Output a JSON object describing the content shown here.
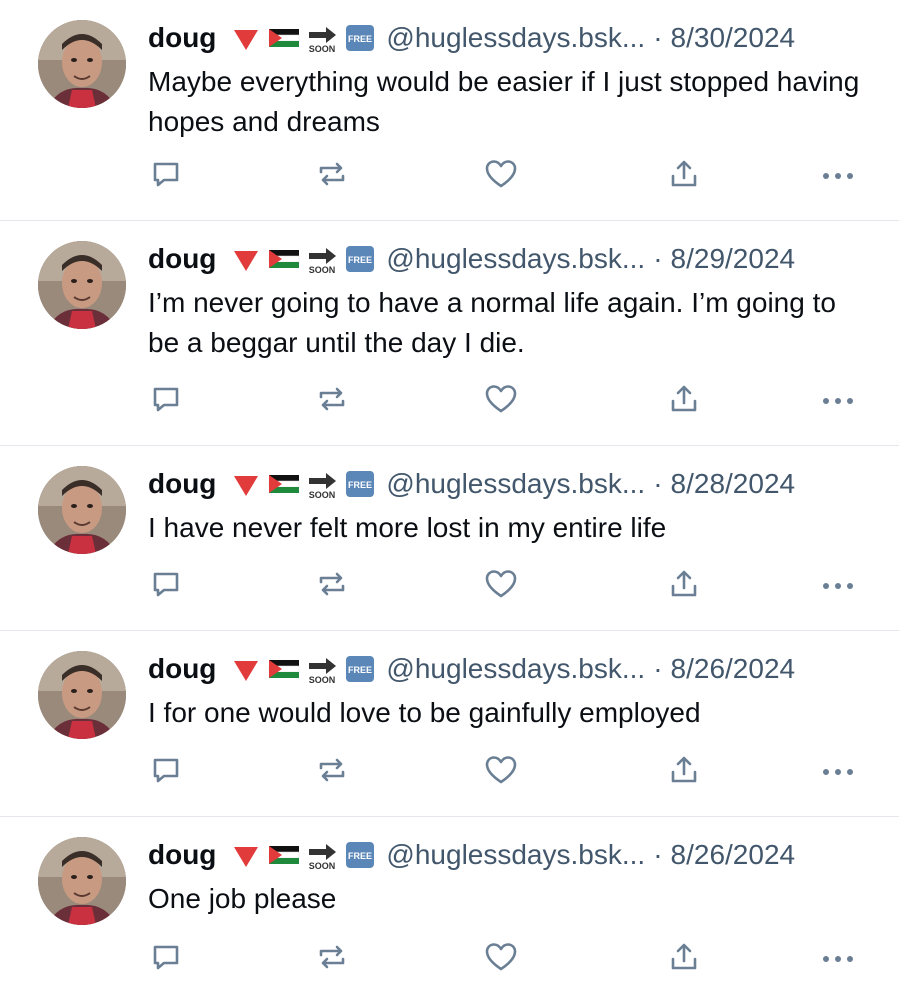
{
  "colors": {
    "text_primary": "#0b0f14",
    "text_secondary": "#42576c",
    "icon": "#6a7f94",
    "divider": "#e4e8ec",
    "flag_red": "#e23b3b",
    "flag_green": "#1f8a3b",
    "free_blue": "#5b86b8"
  },
  "posts": [
    {
      "author_name": "doug",
      "emojis": [
        "red-triangle-down-icon",
        "palestine-flag-icon",
        "soon-arrow-icon",
        "free-button-icon"
      ],
      "handle": "@huglessdays.bsk...",
      "separator": "·",
      "date": "8/30/2024",
      "text": "Maybe everything would be easier if I just stopped having hopes and dreams"
    },
    {
      "author_name": "doug",
      "emojis": [
        "red-triangle-down-icon",
        "palestine-flag-icon",
        "soon-arrow-icon",
        "free-button-icon"
      ],
      "handle": "@huglessdays.bsk...",
      "separator": "·",
      "date": "8/29/2024",
      "text": "I’m never going to have a normal life again. I’m going to be a beggar until the day I die."
    },
    {
      "author_name": "doug",
      "emojis": [
        "red-triangle-down-icon",
        "palestine-flag-icon",
        "soon-arrow-icon",
        "free-button-icon"
      ],
      "handle": "@huglessdays.bsk...",
      "separator": "·",
      "date": "8/28/2024",
      "text": "I have never felt more lost in my entire life"
    },
    {
      "author_name": "doug",
      "emojis": [
        "red-triangle-down-icon",
        "palestine-flag-icon",
        "soon-arrow-icon",
        "free-button-icon"
      ],
      "handle": "@huglessdays.bsk...",
      "separator": "·",
      "date": "8/26/2024",
      "text": "I for one would love to be gainfully employed"
    },
    {
      "author_name": "doug",
      "emojis": [
        "red-triangle-down-icon",
        "palestine-flag-icon",
        "soon-arrow-icon",
        "free-button-icon"
      ],
      "handle": "@huglessdays.bsk...",
      "separator": "·",
      "date": "8/26/2024",
      "text": "One job please"
    }
  ],
  "emoji_text": {
    "soon": "SOON",
    "free": "FREE"
  },
  "action_icons": [
    "reply-icon",
    "repost-icon",
    "like-icon",
    "share-icon",
    "more-icon"
  ]
}
